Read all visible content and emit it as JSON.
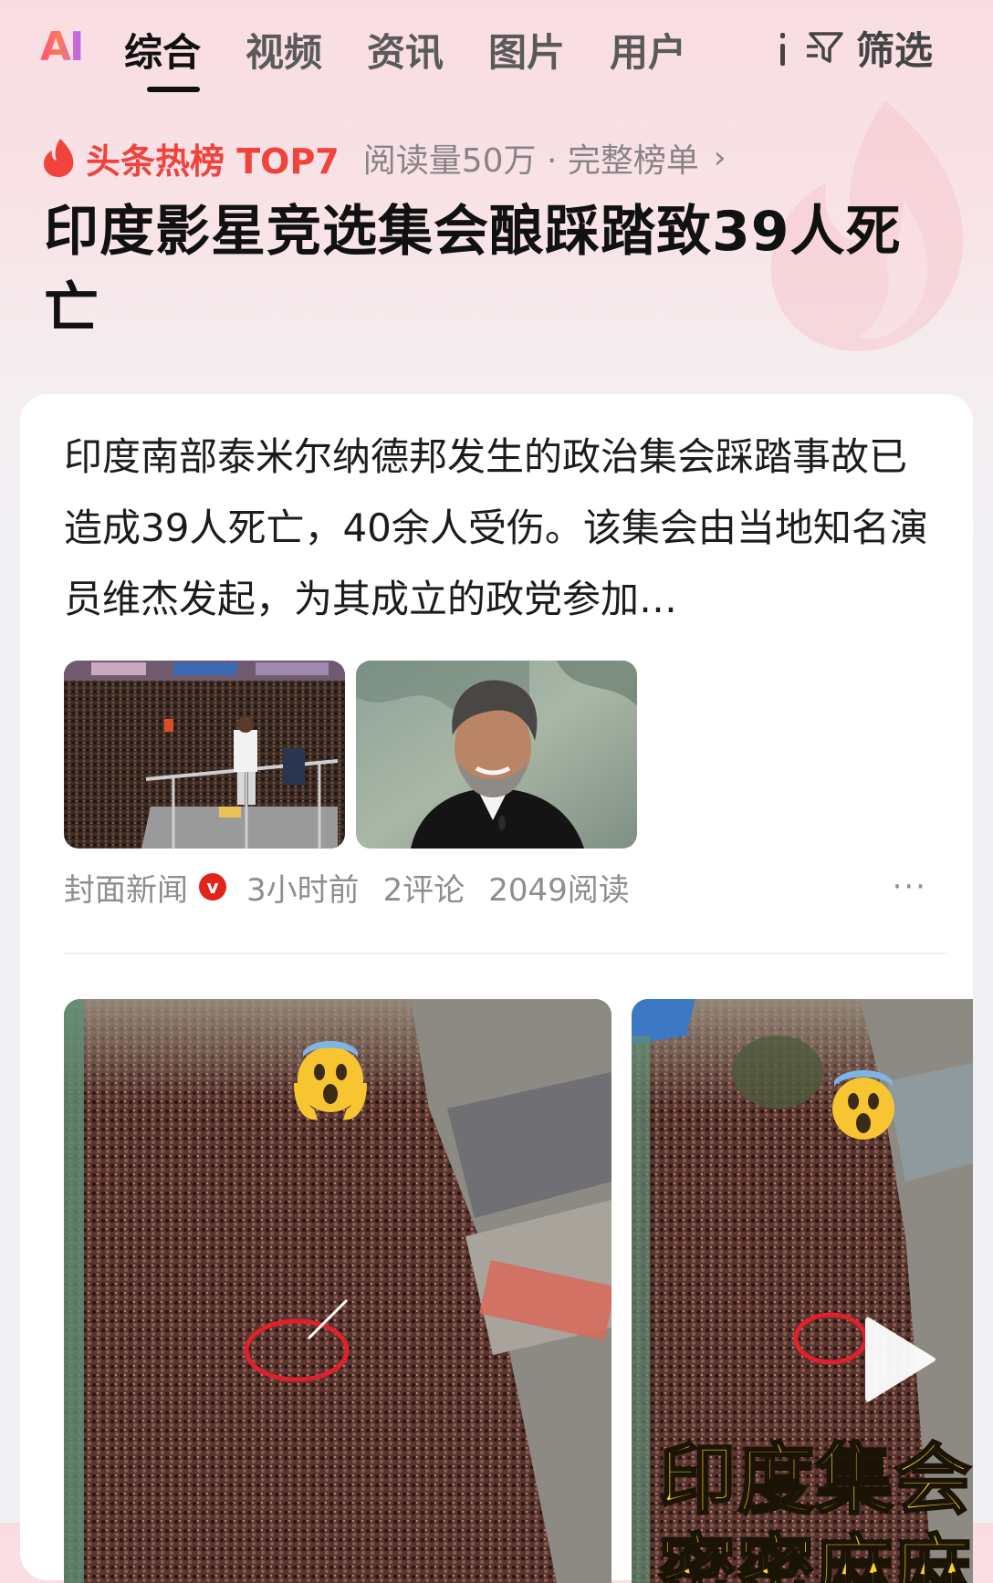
{
  "nav": {
    "ai_label": "AI",
    "tabs": [
      {
        "label": "综合",
        "active": true
      },
      {
        "label": "视频"
      },
      {
        "label": "资讯"
      },
      {
        "label": "图片"
      },
      {
        "label": "用户"
      }
    ],
    "filter_label": "筛选",
    "filter_icon": "filter-icon"
  },
  "hot": {
    "icon": "flame-icon",
    "title": "头条热榜 TOP7",
    "meta": "阅读量50万 · 完整榜单",
    "chevron": "›",
    "color": "#f0433b"
  },
  "headline": "印度影星竞选集会酿踩踏致39人死亡",
  "article": {
    "summary": "印度南部泰米尔纳德邦发生的政治集会踩踏事故已造成39人死亡，40余人受伤。该集会由当地知名演员维杰发起，为其成立的政党参加…",
    "source": "封面新闻",
    "verified_mark": "v",
    "time": "3小时前",
    "comments": "2评论",
    "reads": "2049阅读",
    "more": "···"
  },
  "videos": {
    "emoji": "😱",
    "overlay_line1": "印度集会",
    "overlay_line2": "密密麻麻"
  },
  "colors": {
    "accent": "#f0433b",
    "background_top": "#f9dde2",
    "card": "#ffffff"
  }
}
